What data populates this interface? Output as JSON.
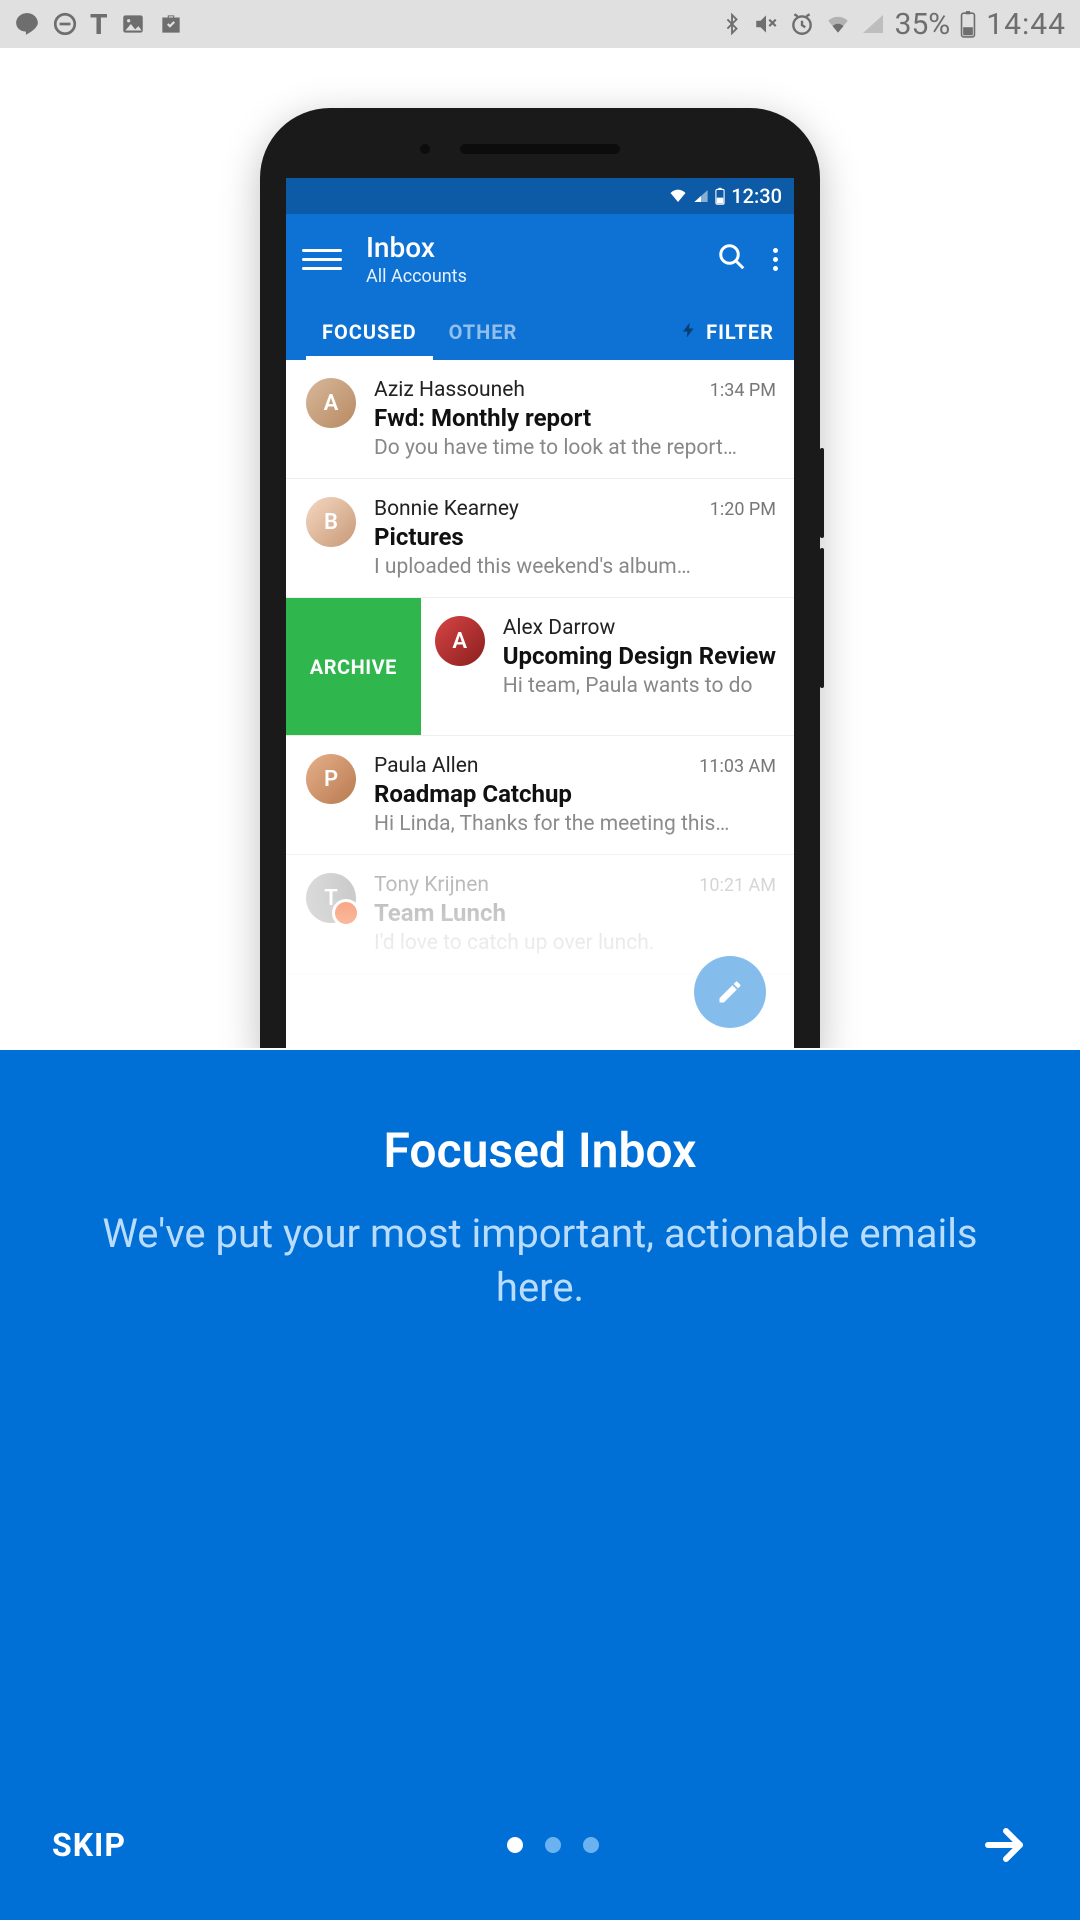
{
  "device_status": {
    "battery_percent": "35%",
    "clock": "14:44"
  },
  "mock_status": {
    "clock": "12:30"
  },
  "appbar": {
    "title": "Inbox",
    "subtitle": "All Accounts"
  },
  "tabs": {
    "focused": "FOCUSED",
    "other": "OTHER",
    "filter": "FILTER"
  },
  "archive_label": "ARCHIVE",
  "emails": [
    {
      "from": "Aziz Hassouneh",
      "subject": "Fwd: Monthly report",
      "preview": "Do you have time to look at the report…",
      "time": "1:34 PM",
      "initial": "A",
      "av": "av-a"
    },
    {
      "from": "Bonnie Kearney",
      "subject": "Pictures",
      "preview": "I uploaded this weekend's album…",
      "time": "1:20 PM",
      "initial": "B",
      "av": "av-b"
    },
    {
      "from": "Alex Darrow",
      "subject": "Upcoming Design Review",
      "preview": "Hi team, Paula wants to do",
      "time": "",
      "initial": "A",
      "av": "av-c"
    },
    {
      "from": "Paula Allen",
      "subject": "Roadmap Catchup",
      "preview": "Hi Linda, Thanks for the meeting this…",
      "time": "11:03 AM",
      "initial": "P",
      "av": "av-d"
    },
    {
      "from": "Tony Krijnen",
      "subject": "Team Lunch",
      "preview": "I'd love to catch up over lunch.",
      "time": "10:21 AM",
      "initial": "T",
      "av": "av-e"
    }
  ],
  "onboarding": {
    "title": "Focused Inbox",
    "subtitle": "We've put your most important, actionable emails here.",
    "skip": "SKIP"
  }
}
